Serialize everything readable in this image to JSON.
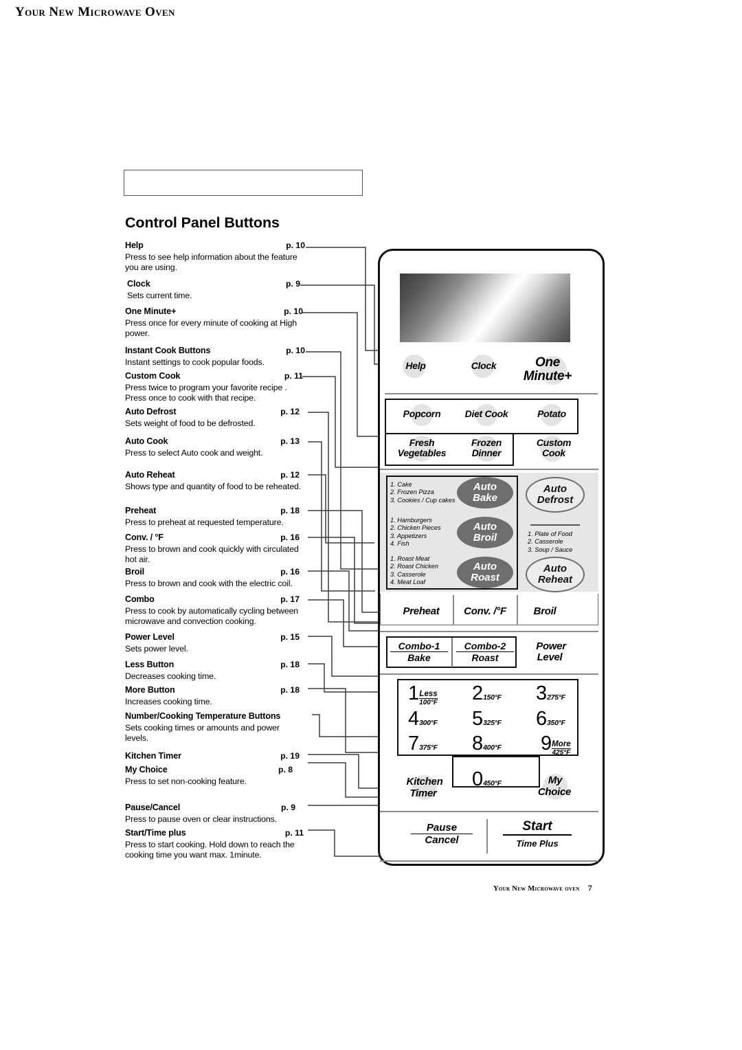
{
  "header": {
    "chapter_title": "Your New Microwave Oven",
    "section_title": "Control Panel Buttons"
  },
  "footer": {
    "text": "Your New Microwave oven",
    "page_number": "7"
  },
  "specs": [
    {
      "name": "Help",
      "page": "p. 10",
      "desc": "Press to see help information about the feature you are using."
    },
    {
      "name": "Clock",
      "page": "p. 9",
      "desc": "Sets current time."
    },
    {
      "name": "One Minute+",
      "page": "p. 10",
      "desc": "Press once for every minute of cooking at High power."
    },
    {
      "name": "Instant Cook Buttons",
      "page": "p. 10",
      "desc": "Instant settings to cook popular foods."
    },
    {
      "name": "Custom Cook",
      "page": "p. 11",
      "desc": "Press twice to program your favorite recipe . Press once to cook with that recipe."
    },
    {
      "name": "Auto Defrost",
      "page": "p. 12",
      "desc": "Sets weight of food to be defrosted."
    },
    {
      "name": "Auto Cook",
      "page": "p. 13",
      "desc": "Press to select Auto cook and weight."
    },
    {
      "name": "Auto Reheat",
      "page": "p. 12",
      "desc": "Shows type and quantity of food to be reheated."
    },
    {
      "name": "Preheat",
      "page": "p. 18",
      "desc": "Press to preheat at requested temperature."
    },
    {
      "name": "Conv. / °F",
      "page": "p. 16",
      "desc": "Press to brown and cook quickly with circulated hot air."
    },
    {
      "name": "Broil",
      "page": "p. 16",
      "desc": "Press to brown and cook with the electric coil."
    },
    {
      "name": "Combo",
      "page": "p. 17",
      "desc": "Press to cook by automatically cycling between microwave and convection cooking."
    },
    {
      "name": "Power Level",
      "page": "p. 15",
      "desc": "Sets power level."
    },
    {
      "name": "Less Button",
      "page": "p. 18",
      "desc": "Decreases cooking time."
    },
    {
      "name": "More Button",
      "page": "p. 18",
      "desc": "Increases cooking time."
    },
    {
      "name": "Number/Cooking Temperature Buttons",
      "page": "",
      "desc": "Sets cooking times or amounts and power levels."
    },
    {
      "name": "Kitchen Timer",
      "page": "p. 19",
      "desc": ""
    },
    {
      "name": "My Choice",
      "page": "p. 8",
      "desc": "Press to set non-cooking feature."
    },
    {
      "name": "Pause/Cancel",
      "page": "p. 9",
      "desc": "Press to pause oven or clear instructions."
    },
    {
      "name": "Start/Time plus",
      "page": "p. 11",
      "desc": "Press to start cooking. Hold down to reach the cooking time you want max. 1minute."
    }
  ],
  "panel": {
    "top_row": {
      "help": "Help",
      "clock": "Clock",
      "one_minute_line1": "One",
      "one_minute_line2": "Minute+"
    },
    "instant_cook": {
      "popcorn": "Popcorn",
      "diet_cook": "Diet Cook",
      "potato": "Potato",
      "fresh_vegetables_l1": "Fresh",
      "fresh_vegetables_l2": "Vegetables",
      "frozen_dinner_l1": "Frozen",
      "frozen_dinner_l2": "Dinner",
      "custom_cook_l1": "Custom",
      "custom_cook_l2": "Cook"
    },
    "auto_section": {
      "bake": {
        "label_l1": "Auto",
        "label_l2": "Bake",
        "items": [
          "1. Cake",
          "2. Frozen Pizza",
          "3. Cookies / Cup cakes"
        ]
      },
      "broil": {
        "label_l1": "Auto",
        "label_l2": "Broil",
        "items": [
          "1. Hamburgers",
          "2. Chicken Pieces",
          "3. Appetizers",
          "4. Fish"
        ]
      },
      "roast": {
        "label_l1": "Auto",
        "label_l2": "Roast",
        "items": [
          "1. Roast Meat",
          "2. Roast Chicken",
          "3. Casserole",
          "4. Meat Loaf"
        ]
      },
      "defrost": {
        "label_l1": "Auto",
        "label_l2": "Defrost"
      },
      "reheat": {
        "label_l1": "Auto",
        "label_l2": "Reheat",
        "items": [
          "1. Plate of Food",
          "2. Casserole",
          "3. Soup / Sauce"
        ]
      }
    },
    "cook_mode_row": {
      "preheat": "Preheat",
      "conv": "Conv. /°F",
      "broil": "Broil"
    },
    "combo_row": {
      "combo1_top": "Combo-1",
      "combo1_bottom": "Bake",
      "combo2_top": "Combo-2",
      "combo2_bottom": "Roast",
      "power_l1": "Power",
      "power_l2": "Level"
    },
    "keypad": [
      {
        "digit": "1",
        "over": "Less",
        "under": "100°F"
      },
      {
        "digit": "2",
        "temp": "150°F"
      },
      {
        "digit": "3",
        "temp": "275°F"
      },
      {
        "digit": "4",
        "temp": "300°F"
      },
      {
        "digit": "5",
        "temp": "325°F"
      },
      {
        "digit": "6",
        "temp": "350°F"
      },
      {
        "digit": "7",
        "temp": "375°F"
      },
      {
        "digit": "8",
        "temp": "400°F"
      },
      {
        "digit": "9",
        "over": "More",
        "under": "425°F"
      },
      {
        "digit": "0",
        "temp": "450°F"
      }
    ],
    "bottom_row": {
      "kitchen_timer_l1": "Kitchen",
      "kitchen_timer_l2": "Timer",
      "my_choice_l1": "My",
      "my_choice_l2": "Choice",
      "pause_top": "Pause",
      "pause_bottom": "Cancel",
      "start_top": "Start",
      "start_bottom": "Time Plus"
    }
  },
  "colors": {
    "panel_border": "#111111",
    "pad_gray": "#e3e3e3",
    "pill_gray": "#6e6e6e",
    "band_gray": "#e6e6e6"
  }
}
